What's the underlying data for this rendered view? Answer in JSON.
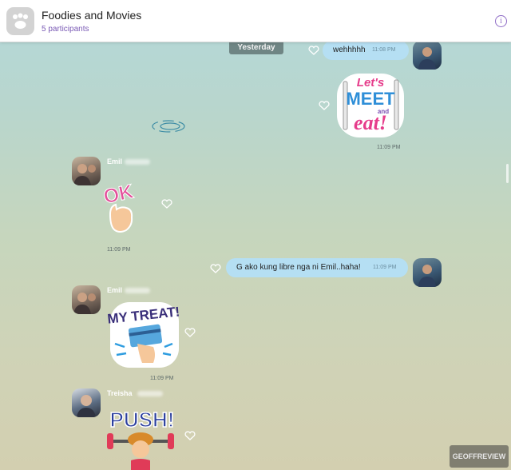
{
  "chat": {
    "title": "Foodies and Movies",
    "participants": "5 participants",
    "info_label": "i"
  },
  "day_separator": "Yesterday",
  "messages": [
    {
      "sender": "",
      "text": "wehhhhh",
      "time": "11:08 PM"
    },
    {
      "sender": "",
      "sticker": "Let's MEET and eat!",
      "time": "11:09 PM"
    },
    {
      "sender": "Emil",
      "sticker": "OK",
      "time": "11:09 PM"
    },
    {
      "sender": "",
      "text": "G ako kung libre nga ni Emil..haha!",
      "time": "11:09 PM"
    },
    {
      "sender": "Emil",
      "sticker": "MY TREAT!",
      "time": "11:09 PM"
    },
    {
      "sender": "Treisha",
      "sticker": "PUSH!",
      "time": ""
    }
  ],
  "watermark": "GEOFFREVIEW",
  "colors": {
    "accent": "#7a5ab5",
    "bubble": "#b5dff3",
    "header_bg": "#ffffff"
  },
  "icons": [
    "group-icon",
    "info-icon",
    "heart-icon"
  ]
}
